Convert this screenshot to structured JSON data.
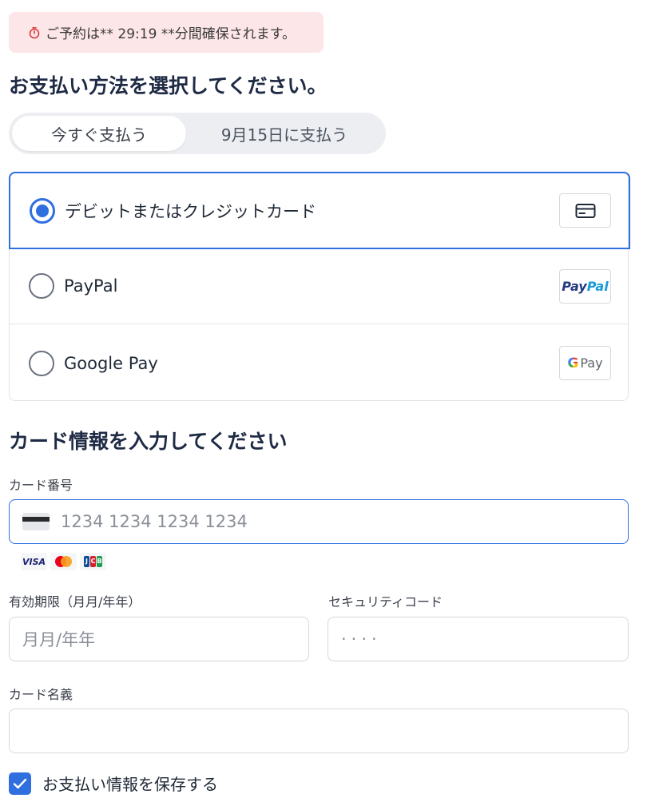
{
  "timer": {
    "text": "ご予約は** 29:19 **分間確保されます。"
  },
  "payment_method_title": "お支払い方法を選択してください。",
  "pay_timing": {
    "options": [
      "今すぐ支払う",
      "9月15日に支払う"
    ],
    "selected": 0
  },
  "methods": [
    {
      "label": "デビットまたはクレジットカード",
      "icon": "credit-card-icon",
      "selected": true
    },
    {
      "label": "PayPal",
      "logo_text_1": "Pay",
      "logo_text_2": "Pal",
      "selected": false
    },
    {
      "label": "Google Pay",
      "logo_g": "G",
      "logo_text": "Pay",
      "selected": false
    }
  ],
  "card_section_title": "カード情報を入力してください",
  "card_number": {
    "label": "カード番号",
    "placeholder": "1234 1234 1234 1234",
    "brands": [
      "VISA",
      "Mastercard",
      "JCB"
    ]
  },
  "expiry": {
    "label": "有効期限（月月/年年）",
    "placeholder": "月月/年年"
  },
  "cvc": {
    "label": "セキュリティコード",
    "placeholder": "····"
  },
  "cardholder": {
    "label": "カード名義",
    "placeholder": ""
  },
  "save_payment": {
    "label": "お支払い情報を保存する",
    "checked": true
  },
  "colors": {
    "accent": "#2f6fe0",
    "banner_bg": "#fde6e8",
    "timer_icon": "#d93b3b"
  }
}
